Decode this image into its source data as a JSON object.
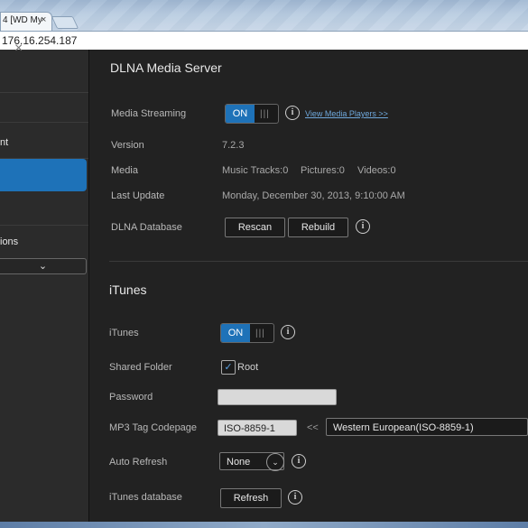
{
  "browser": {
    "tab_title": "4 [WD My",
    "tab_close": "×",
    "address": "176.16.254.187"
  },
  "sidebar": {
    "close_glyph": "×",
    "items": [
      {
        "label": "nt"
      },
      {
        "label": ""
      },
      {
        "label": "ions"
      }
    ],
    "collapse_glyph": "⌄"
  },
  "dlna": {
    "title": "DLNA Media Server",
    "streaming_label": "Media Streaming",
    "toggle_on": "ON",
    "toggle_grip": "|||",
    "view_link": "View Media Players >>",
    "version_label": "Version",
    "version_value": "7.2.3",
    "media_label": "Media",
    "music_tracks": "Music Tracks:0",
    "pictures": "Pictures:0",
    "videos": "Videos:0",
    "last_update_label": "Last Update",
    "last_update_value": "Monday, December 30, 2013, 9:10:00 AM",
    "database_label": "DLNA Database",
    "rescan": "Rescan",
    "rebuild": "Rebuild",
    "info": "i"
  },
  "itunes": {
    "title": "iTunes",
    "itunes_label": "iTunes",
    "toggle_on": "ON",
    "toggle_grip": "|||",
    "shared_folder_label": "Shared Folder",
    "check_glyph": "✓",
    "shared_folder_value": "Root",
    "password_label": "Password",
    "password_value": "",
    "codepage_label": "MP3 Tag Codepage",
    "codepage_value": "ISO-8859-1",
    "arrow_left": "<<",
    "codepage_select": "Western European(ISO-8859-1)",
    "auto_refresh_label": "Auto Refresh",
    "auto_refresh_value": "None",
    "chevron": "⌄",
    "database_label": "iTunes database",
    "refresh": "Refresh",
    "info": "i"
  },
  "colors": {
    "accent": "#1e72b8",
    "background": "#222222",
    "sidebar": "#2b2b2b",
    "link": "#6fa8dc"
  },
  "icons": [
    "close-icon",
    "info-icon",
    "checkmark-icon",
    "chevron-down-icon"
  ]
}
